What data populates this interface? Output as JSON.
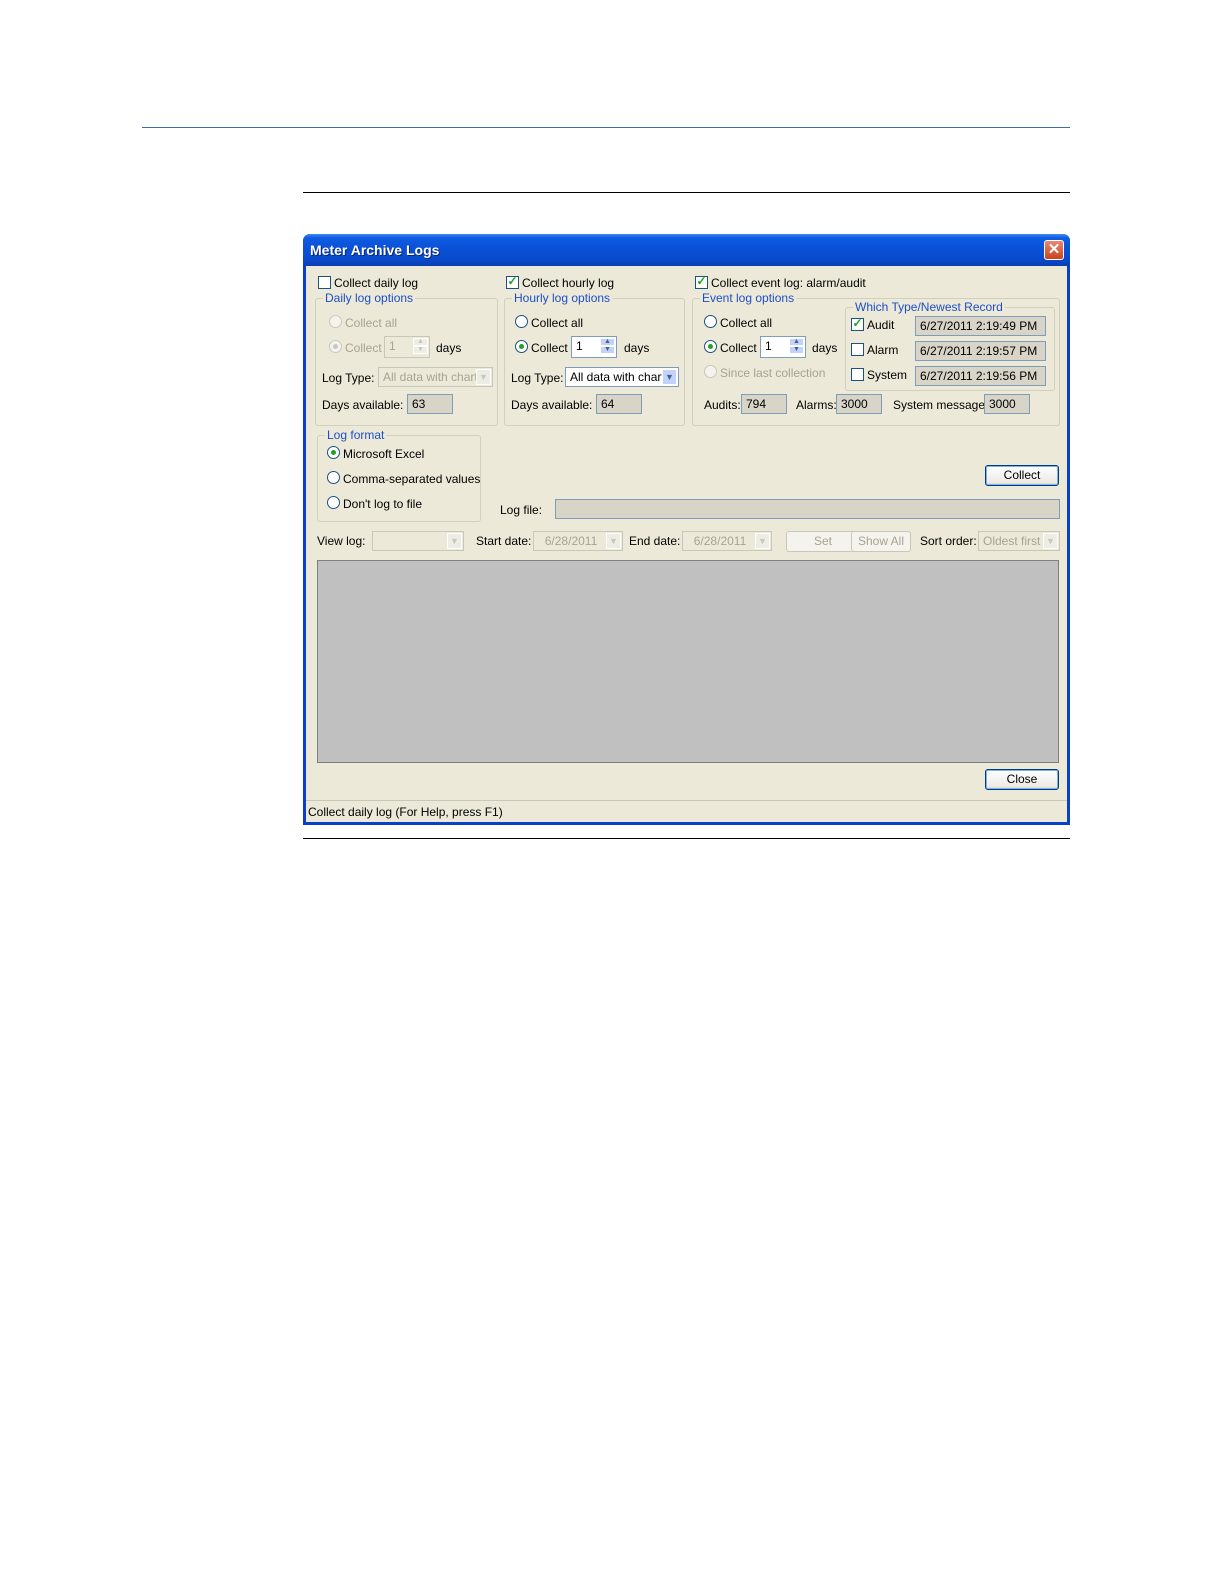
{
  "window": {
    "title": "Meter Archive Logs",
    "close_glyph": "✕",
    "accent_color": "#0a50d6"
  },
  "daily": {
    "checkbox_label": "Collect daily log",
    "checked": false,
    "group_label": "Daily log options",
    "collect_all_label": "Collect all",
    "collect_label": "Collect",
    "days_value": "1",
    "days_label": "days",
    "log_type_label": "Log Type:",
    "log_type_value": "All data with charts",
    "days_available_label": "Days available:",
    "days_available_value": "63"
  },
  "hourly": {
    "checkbox_label": "Collect hourly log",
    "checked": true,
    "group_label": "Hourly log options",
    "collect_all_label": "Collect all",
    "collect_label": "Collect",
    "days_value": "1",
    "days_label": "days",
    "log_type_label": "Log Type:",
    "log_type_value": "All data with charts",
    "days_available_label": "Days available:",
    "days_available_value": "64"
  },
  "event": {
    "checkbox_label": "Collect event log: alarm/audit",
    "checked": true,
    "group_label": "Event log options",
    "collect_all_label": "Collect all",
    "collect_label": "Collect",
    "days_value": "1",
    "days_label": "days",
    "since_last_label": "Since last collection",
    "which_type_label": "Which Type/Newest Record",
    "types": [
      {
        "label": "Audit",
        "checked": true,
        "newest": "6/27/2011 2:19:49 PM"
      },
      {
        "label": "Alarm",
        "checked": false,
        "newest": "6/27/2011 2:19:57 PM"
      },
      {
        "label": "System",
        "checked": false,
        "newest": "6/27/2011 2:19:56 PM"
      }
    ],
    "audits_label": "Audits:",
    "audits_value": "794",
    "alarms_label": "Alarms:",
    "alarms_value": "3000",
    "system_messages_label": "System messages:",
    "system_messages_value": "3000"
  },
  "log_format": {
    "group_label": "Log format",
    "options": [
      "Microsoft Excel",
      "Comma-separated values",
      "Don't log to file"
    ],
    "selected": "Microsoft Excel"
  },
  "collect_button": "Collect",
  "log_file_label": "Log file:",
  "log_file_value": "",
  "view_bar": {
    "view_log_label": "View log:",
    "view_log_value": "",
    "start_date_label": "Start date:",
    "start_date_value": "6/28/2011",
    "end_date_label": "End date:",
    "end_date_value": "6/28/2011",
    "set_button": "Set",
    "show_all_button": "Show All",
    "sort_order_label": "Sort order:",
    "sort_order_value": "Oldest first"
  },
  "close_button": "Close",
  "status_text": "Collect daily log (For Help, press F1)",
  "icons": {
    "check": "✓",
    "spin_up": "▲",
    "spin_down": "▼",
    "dropdown": "▼"
  }
}
